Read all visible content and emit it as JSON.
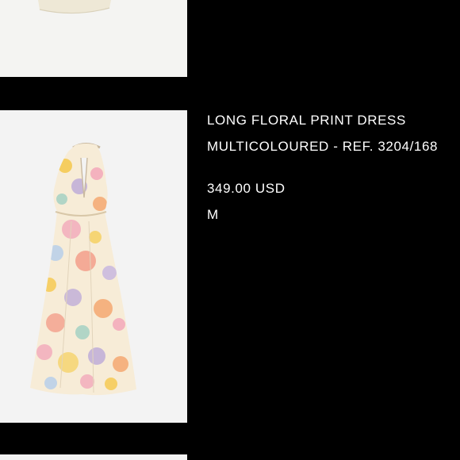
{
  "product": {
    "name": "LONG FLORAL PRINT DRESS",
    "color_ref": "MULTICOLOURED - REF. 3204/168",
    "price": "349.00 USD",
    "size": "M"
  }
}
